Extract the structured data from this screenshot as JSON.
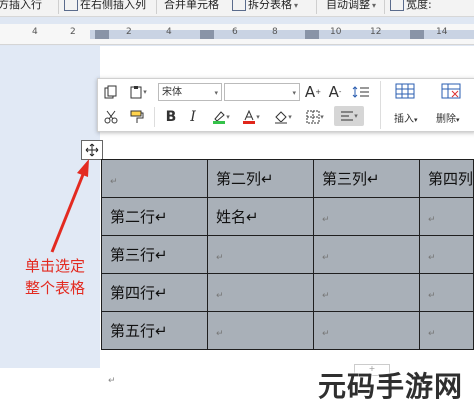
{
  "ribbon": {
    "items": [
      "方插入行",
      "在右侧插入列",
      "合并单元格",
      "拆分表格",
      "自动调整",
      "宽度:"
    ]
  },
  "ruler": {
    "numbers": [
      "4",
      "2",
      "2",
      "4",
      "6",
      "8",
      "10",
      "12",
      "14",
      "16"
    ]
  },
  "mini_toolbar": {
    "font_name": "宋体",
    "font_size": "",
    "bold": "B",
    "italic": "I",
    "grow_font": "A",
    "shrink_font": "A",
    "insert_label": "插入",
    "delete_label": "删除"
  },
  "table": {
    "rows": [
      [
        "↵",
        "第二列↵",
        "第三列↵",
        "第四列"
      ],
      [
        "第二行↵",
        "姓名↵",
        "↵",
        "↵"
      ],
      [
        "第三行↵",
        "↵",
        "↵",
        "↵"
      ],
      [
        "第四行↵",
        "↵",
        "↵",
        "↵"
      ],
      [
        "第五行↵",
        "↵",
        "↵",
        "↵"
      ]
    ]
  },
  "annotation": {
    "line1": "单击选定",
    "line2": "整个表格",
    "color": "#e32a20"
  },
  "add_row": "+",
  "paragraph_mark": "↵",
  "watermark": "元码手游网"
}
